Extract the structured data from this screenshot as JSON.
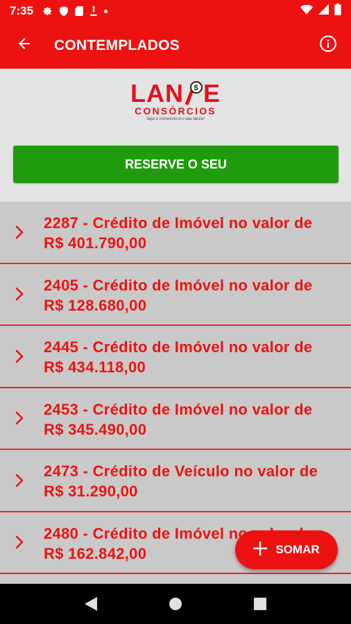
{
  "status_bar": {
    "time": "7:35",
    "icons_left": [
      "gear-icon",
      "shield-icon",
      "sd-card-icon",
      "download-icon",
      "dot-icon"
    ],
    "icons_right": [
      "wifi-icon",
      "signal-icon",
      "battery-icon"
    ]
  },
  "app_bar": {
    "title": "CONTEMPLADOS",
    "back_icon": "arrow-back-icon",
    "info_icon": "info-icon"
  },
  "logo": {
    "brand_left": "LAN",
    "brand_right": "E",
    "subtitle": "CONSÓRCIOS",
    "tagline": "Aqui o consórcio é o seu lance!"
  },
  "reserve_button": {
    "label": "RESERVE O SEU"
  },
  "list": {
    "items": [
      {
        "line1": "2287 - Crédito de Imóvel no valor de",
        "line2": "R$ 401.790,00"
      },
      {
        "line1": "2405 - Crédito de Imóvel no valor de",
        "line2": "R$ 128.680,00"
      },
      {
        "line1": "2445 - Crédito de Imóvel no valor de",
        "line2": "R$ 434.118,00"
      },
      {
        "line1": "2453 - Crédito de Imóvel no valor de",
        "line2": "R$ 345.490,00"
      },
      {
        "line1": "2473 - Crédito de Veículo no valor de",
        "line2": "R$ 31.290,00"
      },
      {
        "line1": "2480 - Crédito de Imóvel no valor de",
        "line2": "R$ 162.842,00"
      }
    ]
  },
  "fab": {
    "label": "SOMAR",
    "icon": "plus-icon"
  },
  "colors": {
    "primary_red": "#ee1111",
    "reserve_green": "#1f9b0d",
    "header_gray": "#e3e3e3",
    "list_gray": "#c9c9c9",
    "nav_black": "#000000"
  }
}
